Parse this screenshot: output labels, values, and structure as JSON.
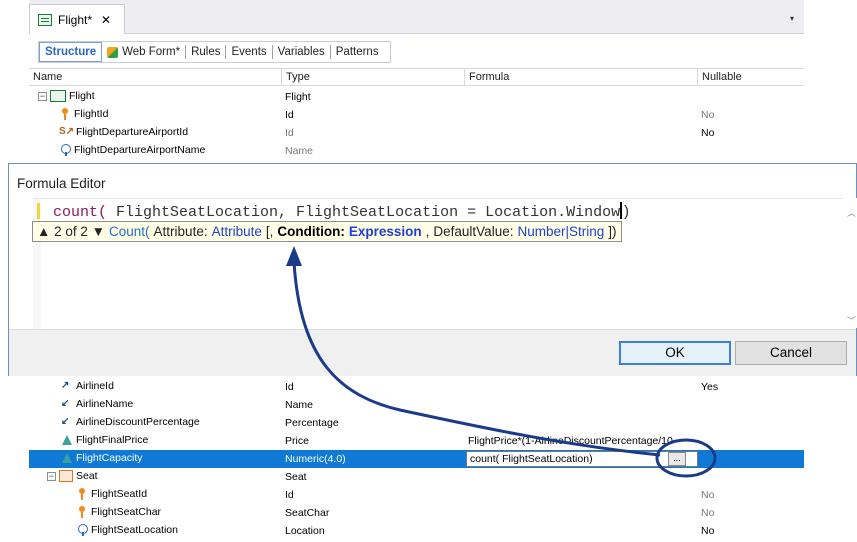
{
  "tab": {
    "label": "Flight*",
    "close": "✕",
    "dropdown": "▾"
  },
  "subtabs": [
    {
      "label": "Structure",
      "active": true
    },
    {
      "label": "Web Form*",
      "icon": "webform-icon"
    },
    {
      "label": "Rules"
    },
    {
      "label": "Events"
    },
    {
      "label": "Variables"
    },
    {
      "label": "Patterns"
    }
  ],
  "grid": {
    "headers": {
      "name": "Name",
      "type": "Type",
      "formula": "Formula",
      "nullable": "Nullable"
    },
    "top_rows": [
      {
        "name": "Flight",
        "type": "Flight",
        "formula": "",
        "nullable": "",
        "icon": "level-icon"
      },
      {
        "name": "FlightId",
        "type": "Id",
        "formula": "",
        "nullable": "No",
        "icon": "key-icon"
      },
      {
        "name": "FlightDepartureAirportId",
        "type": "Id",
        "formula": "",
        "nullable": "No",
        "icon": "subtype-icon"
      },
      {
        "name": "FlightDepartureAirportName",
        "type": "Name",
        "formula": "",
        "nullable": "",
        "icon": "inferred-attribute-icon"
      }
    ],
    "bottom_rows": [
      {
        "name": "AirlineId",
        "type": "Id",
        "formula": "",
        "nullable": "Yes",
        "icon": "foreign-key-icon"
      },
      {
        "name": "AirlineName",
        "type": "Name",
        "formula": "",
        "nullable": "",
        "icon": "inferred-icon"
      },
      {
        "name": "AirlineDiscountPercentage",
        "type": "Percentage",
        "formula": "",
        "nullable": "",
        "icon": "inferred-icon"
      },
      {
        "name": "FlightFinalPrice",
        "type": "Price",
        "formula": "FlightPrice*(1-AirlineDiscountPercentage/10",
        "nullable": "",
        "icon": "formula-icon"
      },
      {
        "name": "FlightCapacity",
        "type": "Numeric(4.0)",
        "formula": "count( FlightSeatLocation)",
        "nullable": "",
        "icon": "formula-icon",
        "selected": true,
        "ellipsis": "..."
      },
      {
        "name": "Seat",
        "type": "Seat",
        "formula": "",
        "nullable": "",
        "icon": "level-icon"
      },
      {
        "name": "FlightSeatId",
        "type": "Id",
        "formula": "",
        "nullable": "No",
        "icon": "key-icon"
      },
      {
        "name": "FlightSeatChar",
        "type": "SeatChar",
        "formula": "",
        "nullable": "No",
        "icon": "key-icon"
      },
      {
        "name": "FlightSeatLocation",
        "type": "Location",
        "formula": "",
        "nullable": "No",
        "icon": "attribute-icon"
      }
    ]
  },
  "dialog": {
    "title": "Formula Editor",
    "code_fn": "count(",
    "code_rest": " FlightSeatLocation, FlightSeatLocation = Location.Window",
    "code_end": ")",
    "tooltip": {
      "counter": "▲ 2 of 2 ▼",
      "fn": "Count(",
      "p1_label": "Attribute:",
      "p1_type": "Attribute",
      "open_bracket": "[,",
      "p2_label": "Condition:",
      "p2_type": "Expression",
      "comma": ",",
      "p3_label": "DefaultValue:",
      "p3_type": "Number|String",
      "close": "])"
    },
    "ok": "OK",
    "cancel": "Cancel"
  },
  "colors": {
    "selection": "#0f7ad6",
    "annotation": "#1a3a8a",
    "accent": "#2a67c4"
  }
}
